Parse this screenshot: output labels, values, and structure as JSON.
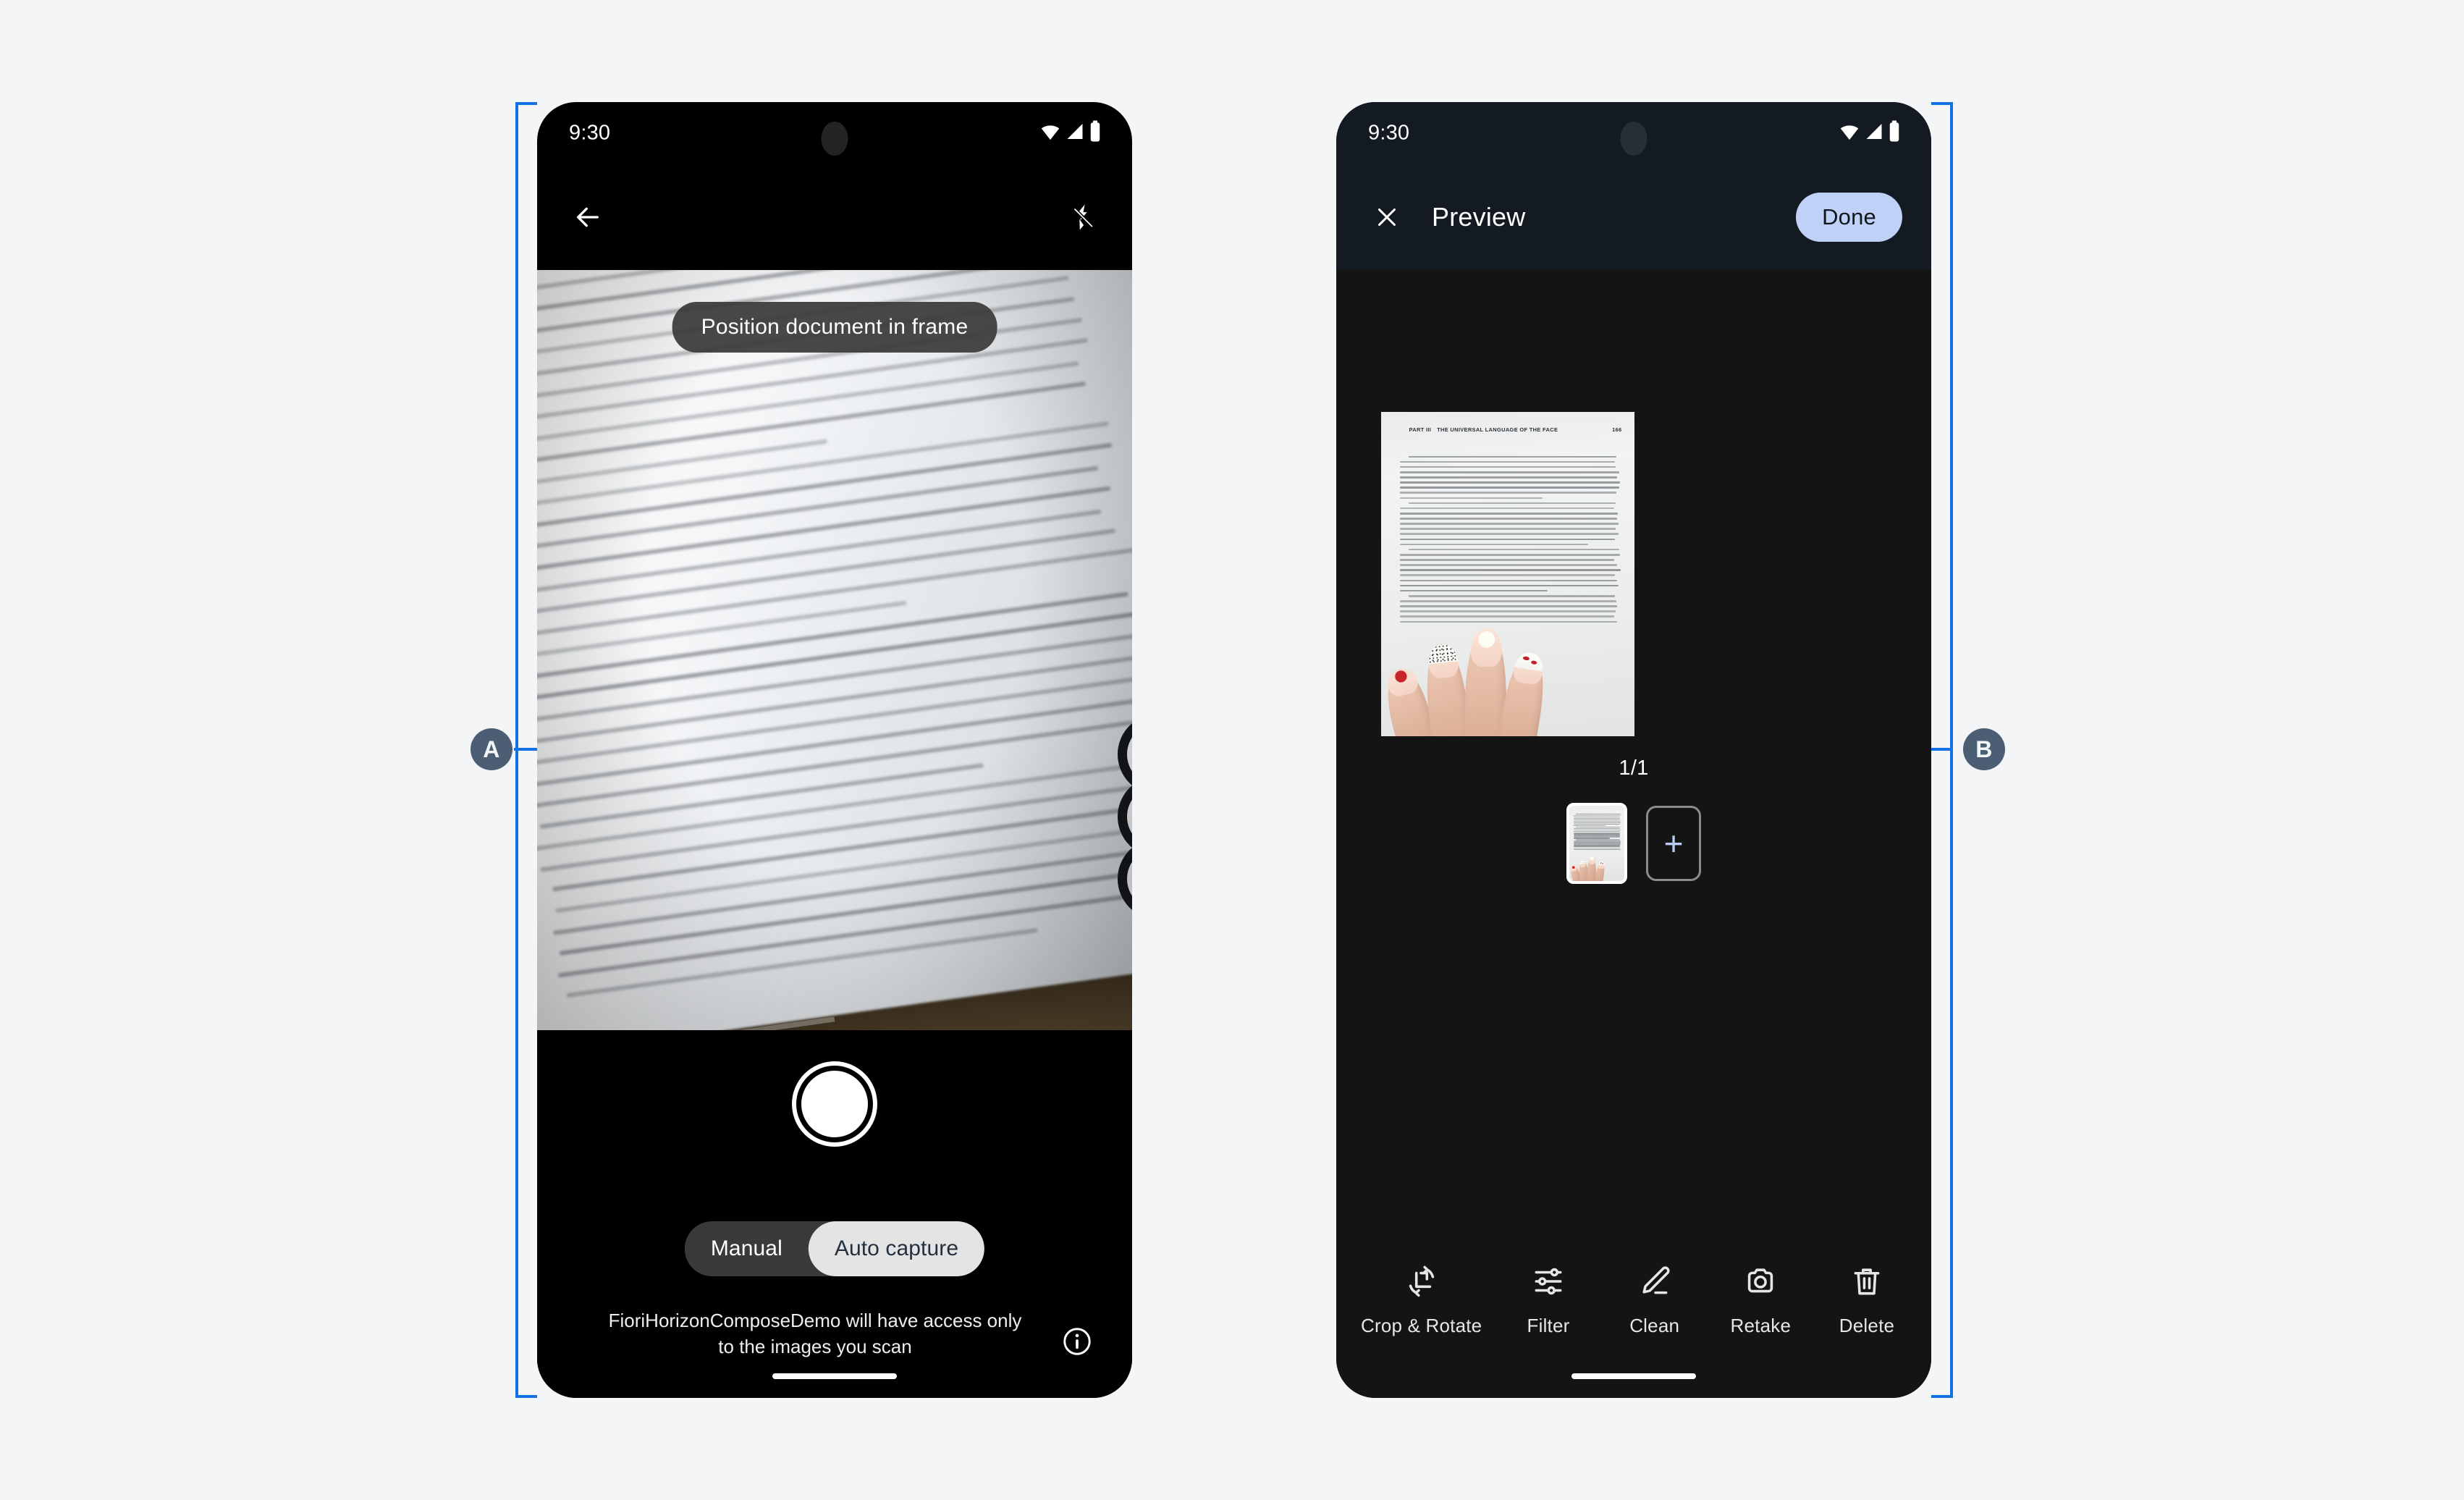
{
  "annotations": {
    "left_badge": "A",
    "right_badge": "B",
    "accent_color": "#1272E5",
    "badge_color": "#4B5E73"
  },
  "phone_a": {
    "status_bar": {
      "time": "9:30",
      "icons": [
        "wifi-icon",
        "cellular-signal-icon",
        "battery-icon"
      ]
    },
    "app_bar": {
      "back_icon": "back-arrow-icon",
      "flash_icon": "flash-off-icon"
    },
    "viewfinder": {
      "hint": "Position document in frame"
    },
    "controls": {
      "shutter_label": "shutter-button",
      "modes": [
        {
          "label": "Manual",
          "active": false
        },
        {
          "label": "Auto capture",
          "active": true
        }
      ],
      "privacy_notice": "FioriHorizonComposeDemo will have access only to the images you scan",
      "info_icon": "info-icon"
    }
  },
  "phone_b": {
    "status_bar": {
      "time": "9:30",
      "icons": [
        "wifi-icon",
        "cellular-signal-icon",
        "battery-icon"
      ]
    },
    "app_bar": {
      "close_icon": "close-icon",
      "title": "Preview",
      "done_label": "Done",
      "done_color": "#BFD1F7"
    },
    "document": {
      "header_part": "PART III",
      "header_title": "THE UNIVERSAL LANGUAGE OF THE FACE",
      "page_number": "166"
    },
    "counter": "1/1",
    "thumbnails": {
      "add_label": "+"
    },
    "toolbar": [
      {
        "label": "Crop & Rotate",
        "icon": "crop-rotate-icon"
      },
      {
        "label": "Filter",
        "icon": "filter-sliders-icon"
      },
      {
        "label": "Clean",
        "icon": "clean-pen-icon"
      },
      {
        "label": "Retake",
        "icon": "camera-retake-icon"
      },
      {
        "label": "Delete",
        "icon": "trash-icon"
      }
    ]
  }
}
